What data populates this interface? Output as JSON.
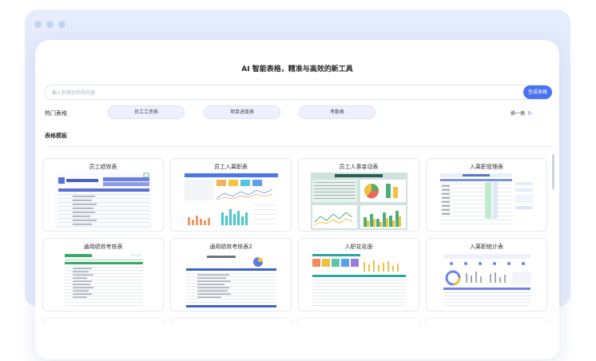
{
  "header": {
    "title": "AI 智能表格，精准与高效的新工具"
  },
  "search": {
    "placeholder": "输入你想创作的内容",
    "button_label": "生成表格"
  },
  "hot": {
    "label": "热门表格",
    "chips": [
      "员工工资表",
      "项目进度表",
      "考勤表"
    ],
    "refresh_label": "换一换",
    "refresh_icon": "refresh-icon"
  },
  "templates": {
    "section_label": "表格模板",
    "cards": [
      {
        "title": "员工绩效表"
      },
      {
        "title": "员工入离职表"
      },
      {
        "title": "员工人事变动表"
      },
      {
        "title": "入离职管理表"
      },
      {
        "title": "通用绩效考核表"
      },
      {
        "title": "通用绩效考核表2"
      },
      {
        "title": "入职花名册"
      },
      {
        "title": "入离职统计表"
      }
    ]
  },
  "colors": {
    "accent": "#4a73f0",
    "frame": "#e5ecfc",
    "chip_bg": "#eef1fd"
  }
}
